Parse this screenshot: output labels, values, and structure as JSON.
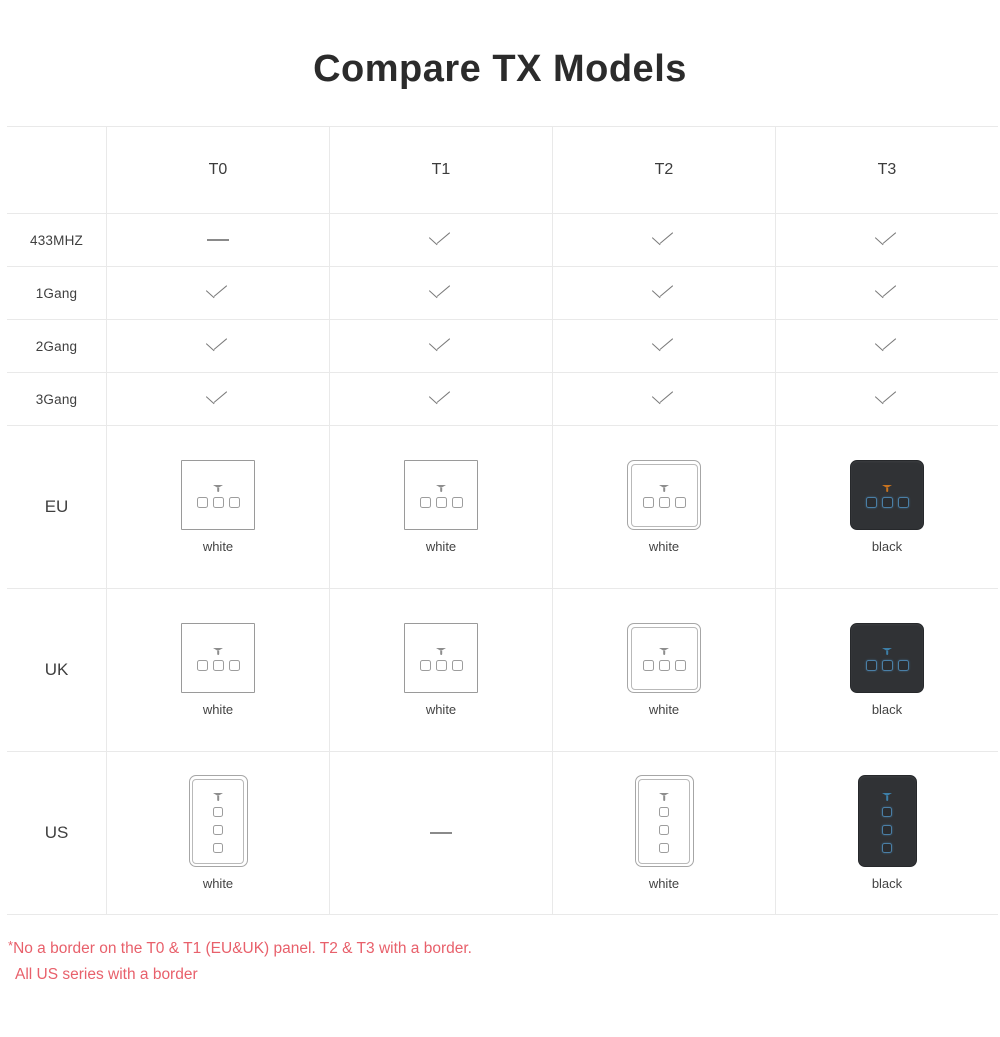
{
  "title": "Compare TX Models",
  "table": {
    "corner_label": "",
    "models": [
      "T0",
      "T1",
      "T2",
      "T3"
    ],
    "feature_rows": [
      {
        "label": "433MHZ",
        "cells": [
          "dash",
          "check",
          "check",
          "check"
        ]
      },
      {
        "label": "1Gang",
        "cells": [
          "check",
          "check",
          "check",
          "check"
        ]
      },
      {
        "label": "2Gang",
        "cells": [
          "check",
          "check",
          "check",
          "check"
        ]
      },
      {
        "label": "3Gang",
        "cells": [
          "check",
          "check",
          "check",
          "check"
        ]
      }
    ],
    "panel_rows": [
      {
        "label": "EU",
        "cells": [
          {
            "kind": "panel",
            "shape": "square",
            "style": "white-plain",
            "color_label": "white",
            "buttons": 3,
            "layout": "row",
            "wifi": "gray"
          },
          {
            "kind": "panel",
            "shape": "square",
            "style": "white-plain",
            "color_label": "white",
            "buttons": 3,
            "layout": "row",
            "wifi": "gray"
          },
          {
            "kind": "panel",
            "shape": "square",
            "style": "white-frame",
            "color_label": "white",
            "buttons": 3,
            "layout": "row",
            "wifi": "gray"
          },
          {
            "kind": "panel",
            "shape": "square",
            "style": "black",
            "color_label": "black",
            "buttons": 3,
            "layout": "row",
            "wifi": "amber"
          }
        ]
      },
      {
        "label": "UK",
        "cells": [
          {
            "kind": "panel",
            "shape": "square",
            "style": "white-plain",
            "color_label": "white",
            "buttons": 3,
            "layout": "row",
            "wifi": "gray"
          },
          {
            "kind": "panel",
            "shape": "square",
            "style": "white-plain",
            "color_label": "white",
            "buttons": 3,
            "layout": "row",
            "wifi": "gray"
          },
          {
            "kind": "panel",
            "shape": "square",
            "style": "white-frame",
            "color_label": "white",
            "buttons": 3,
            "layout": "row",
            "wifi": "gray"
          },
          {
            "kind": "panel",
            "shape": "square",
            "style": "black",
            "color_label": "black",
            "buttons": 3,
            "layout": "row",
            "wifi": "cyan"
          }
        ]
      },
      {
        "label": "US",
        "cells": [
          {
            "kind": "panel",
            "shape": "vertical",
            "style": "white-frame",
            "color_label": "white",
            "buttons": 3,
            "layout": "col",
            "wifi": "gray"
          },
          {
            "kind": "dash"
          },
          {
            "kind": "panel",
            "shape": "vertical",
            "style": "white-frame",
            "color_label": "white",
            "buttons": 3,
            "layout": "col",
            "wifi": "gray"
          },
          {
            "kind": "panel",
            "shape": "vertical",
            "style": "black",
            "color_label": "black",
            "buttons": 3,
            "layout": "col",
            "wifi": "cyan"
          }
        ]
      }
    ]
  },
  "footnote": {
    "star": "*",
    "line1": "No a border on the T0 & T1 (EU&UK) panel. T2 & T3 with a border.",
    "line2": "All US series with a border",
    "color": "#e8606b"
  }
}
